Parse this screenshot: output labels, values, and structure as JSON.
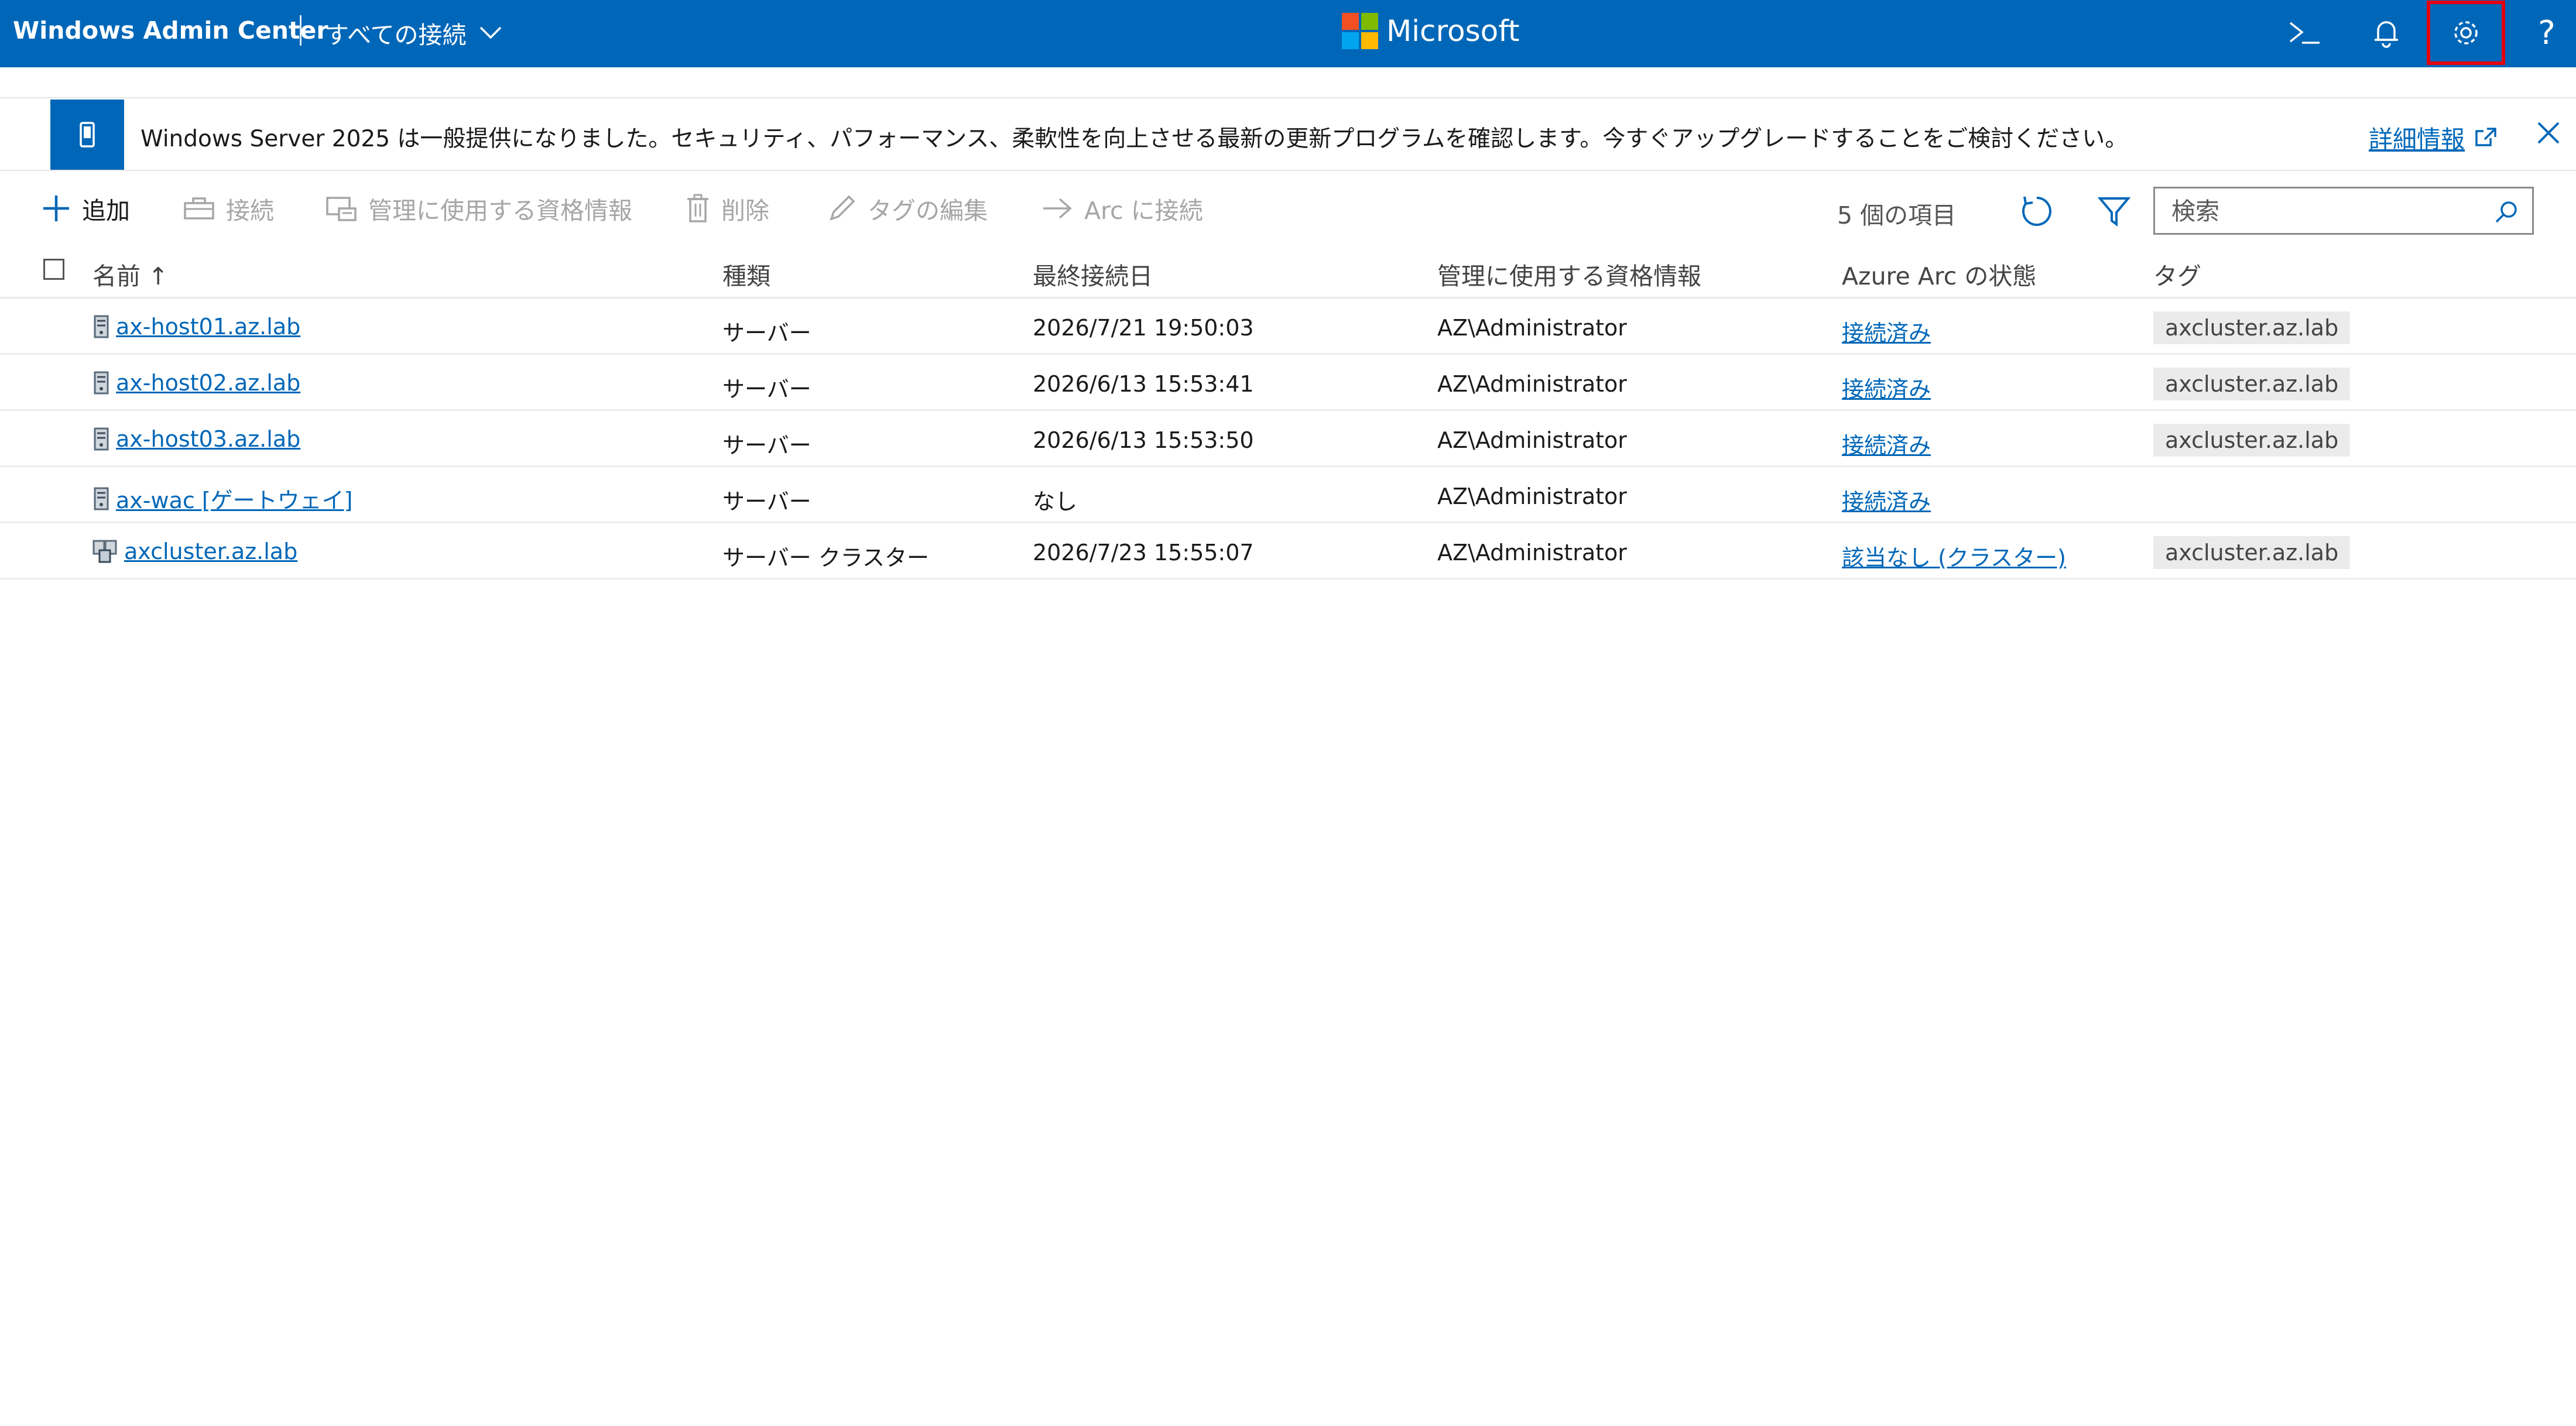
{
  "header": {
    "app_title": "Windows Admin Center",
    "connections_label": "すべての接続",
    "brand": "Microsoft",
    "brand_colors": [
      "#f25022",
      "#7fba00",
      "#00a4ef",
      "#ffb900"
    ],
    "icons": [
      "terminal-icon",
      "bell-icon",
      "gear-icon",
      "help-icon"
    ],
    "help_glyph": "?"
  },
  "banner": {
    "message": "Windows Server 2025 は一般提供になりました。セキュリティ、パフォーマンス、柔軟性を向上させる最新の更新プログラムを確認します。今すぐアップグレードすることをご検討ください。",
    "link_label": "詳細情報"
  },
  "toolbar": {
    "add": "追加",
    "connect": "接続",
    "manage_creds": "管理に使用する資格情報",
    "delete": "削除",
    "edit_tags": "タグの編集",
    "arc_connect": "Arc に接続",
    "item_count": "5 個の項目",
    "search_placeholder": "検索"
  },
  "table": {
    "columns": [
      "名前 ↑",
      "種類",
      "最終接続日",
      "管理に使用する資格情報",
      "Azure Arc の状態",
      "タグ"
    ],
    "rows": [
      {
        "name": "ax-host01.az.lab",
        "type": "サーバー",
        "last": "2026/7/21 19:50:03",
        "cred": "AZ\\Administrator",
        "arc": "接続済み",
        "tag": "axcluster.az.lab",
        "icon": "server-icon"
      },
      {
        "name": "ax-host02.az.lab",
        "type": "サーバー",
        "last": "2026/6/13 15:53:41",
        "cred": "AZ\\Administrator",
        "arc": "接続済み",
        "tag": "axcluster.az.lab",
        "icon": "server-icon"
      },
      {
        "name": "ax-host03.az.lab",
        "type": "サーバー",
        "last": "2026/6/13 15:53:50",
        "cred": "AZ\\Administrator",
        "arc": "接続済み",
        "tag": "axcluster.az.lab",
        "icon": "server-icon"
      },
      {
        "name": "ax-wac [ゲートウェイ]",
        "type": "サーバー",
        "last": "なし",
        "cred": "AZ\\Administrator",
        "arc": "接続済み",
        "tag": "",
        "icon": "server-icon"
      },
      {
        "name": "axcluster.az.lab",
        "type": "サーバー クラスター",
        "last": "2026/7/23 15:55:07",
        "cred": "AZ\\Administrator",
        "arc": "該当なし (クラスター)",
        "tag": "axcluster.az.lab",
        "icon": "cluster-icon"
      }
    ]
  }
}
